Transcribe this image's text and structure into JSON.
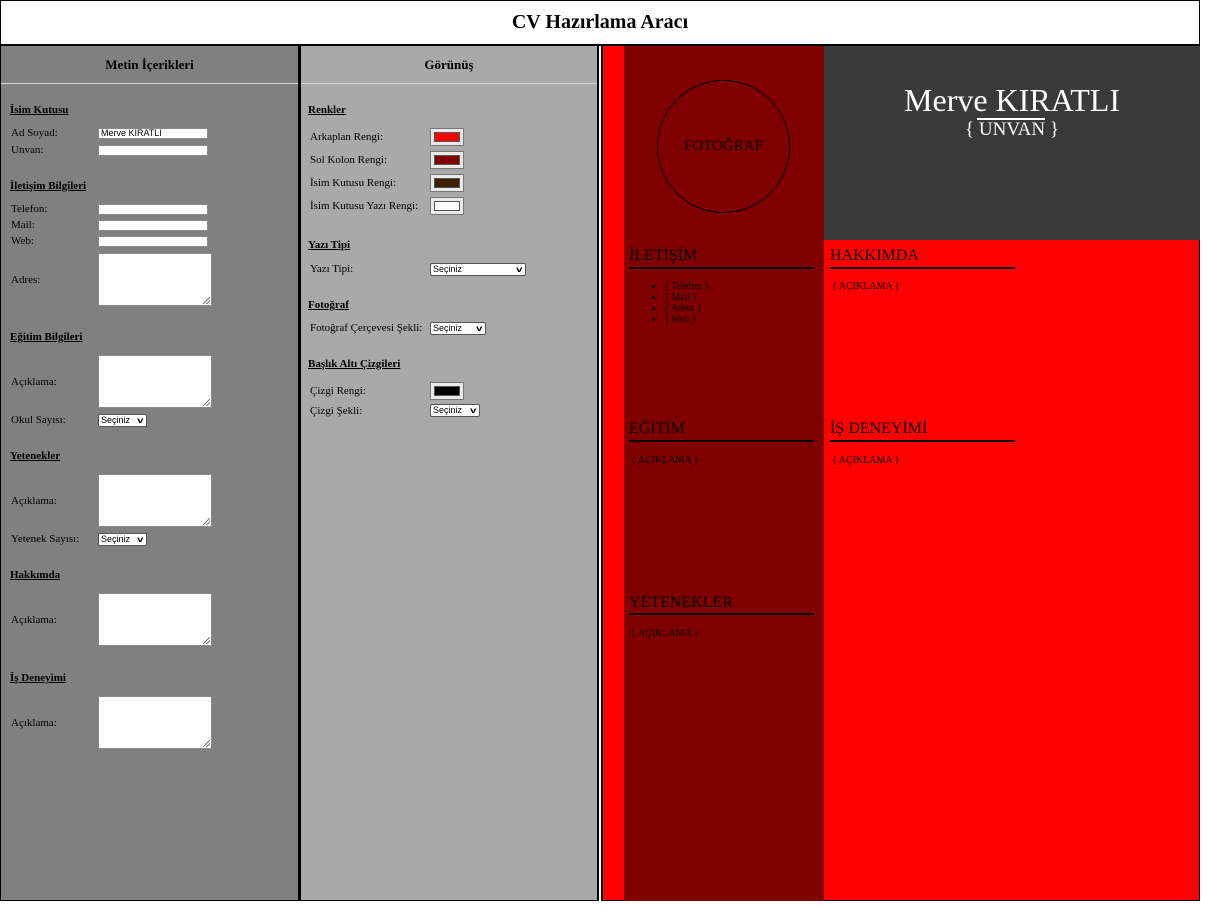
{
  "app": {
    "title": "CV Hazırlama Aracı"
  },
  "left": {
    "title": "Metin İçerikleri",
    "name_section": {
      "title": "İsim Kutusu",
      "name_label": "Ad Soyad:",
      "name_value": "Merve KIRATLI",
      "title_label": "Unvan:",
      "title_value": ""
    },
    "contact_section": {
      "title": "İletişim Bilgileri",
      "phone_label": "Telefon:",
      "mail_label": "Mail:",
      "web_label": "Web:",
      "address_label": "Adres:"
    },
    "education_section": {
      "title": "Eğitim Bilgileri",
      "desc_label": "Açıklama:",
      "count_label": "Okul Sayısı:",
      "count_value": "Seçiniz"
    },
    "skills_section": {
      "title": "Yetenekler",
      "desc_label": "Açıklama:",
      "count_label": "Yetenek Sayısı:",
      "count_value": "Seçiniz"
    },
    "about_section": {
      "title": "Hakkımda",
      "desc_label": "Açıklama:"
    },
    "work_section": {
      "title": "İş Deneyimi",
      "desc_label": "Açıklama:"
    }
  },
  "mid": {
    "title": "Görünüş",
    "colors_section": {
      "title": "Renkler",
      "bg_label": "Arkaplan Rengi:",
      "bg_color": "#ff0000",
      "leftcol_label": "Sol Kolon Rengi:",
      "leftcol_color": "#800000",
      "namebox_label": "İsim Kutusu Rengi:",
      "namebox_color": "#3b2000",
      "nametext_label": "İsim Kutusu Yazı Rengi:",
      "nametext_color": "#ffffff"
    },
    "font_section": {
      "title": "Yazı Tipi",
      "label": "Yazı Tipi:",
      "value": "Seçiniz"
    },
    "photo_section": {
      "title": "Fotoğraf",
      "label": "Fotoğraf Çerçevesi Şekli:",
      "value": "Seçiniz"
    },
    "line_section": {
      "title": "Başlık Altı Çizgileri",
      "color_label": "Çizgi Rengi:",
      "color": "#000000",
      "shape_label": "Çizgi Şekli:",
      "shape_value": "Seçiniz"
    }
  },
  "cv": {
    "name": "Merve KIRATLI",
    "title": "{ UNVAN }",
    "photo": "FOTOĞRAF",
    "contact_heading": "İLETİŞİM",
    "contact_items": [
      "{ Telefon }",
      "{ Mail }",
      "{ Adres }",
      "{ Web }"
    ],
    "about_heading": "HAKKIMDA",
    "about_desc": "{ AÇIKLAMA }",
    "education_heading": "EĞİTİM",
    "education_desc": "{ AÇIKLAMA }",
    "work_heading": "İŞ DENEYİMİ",
    "work_desc": "{ AÇIKLAMA }",
    "skills_heading": "YETENEKLER",
    "skills_desc": "{ AÇIKLAMA }",
    "colors": {
      "background": "#ff0000",
      "left_column": "#800000",
      "name_box": "#3a3a3a",
      "name_text": "#ffffff",
      "lines": "#000000"
    }
  }
}
